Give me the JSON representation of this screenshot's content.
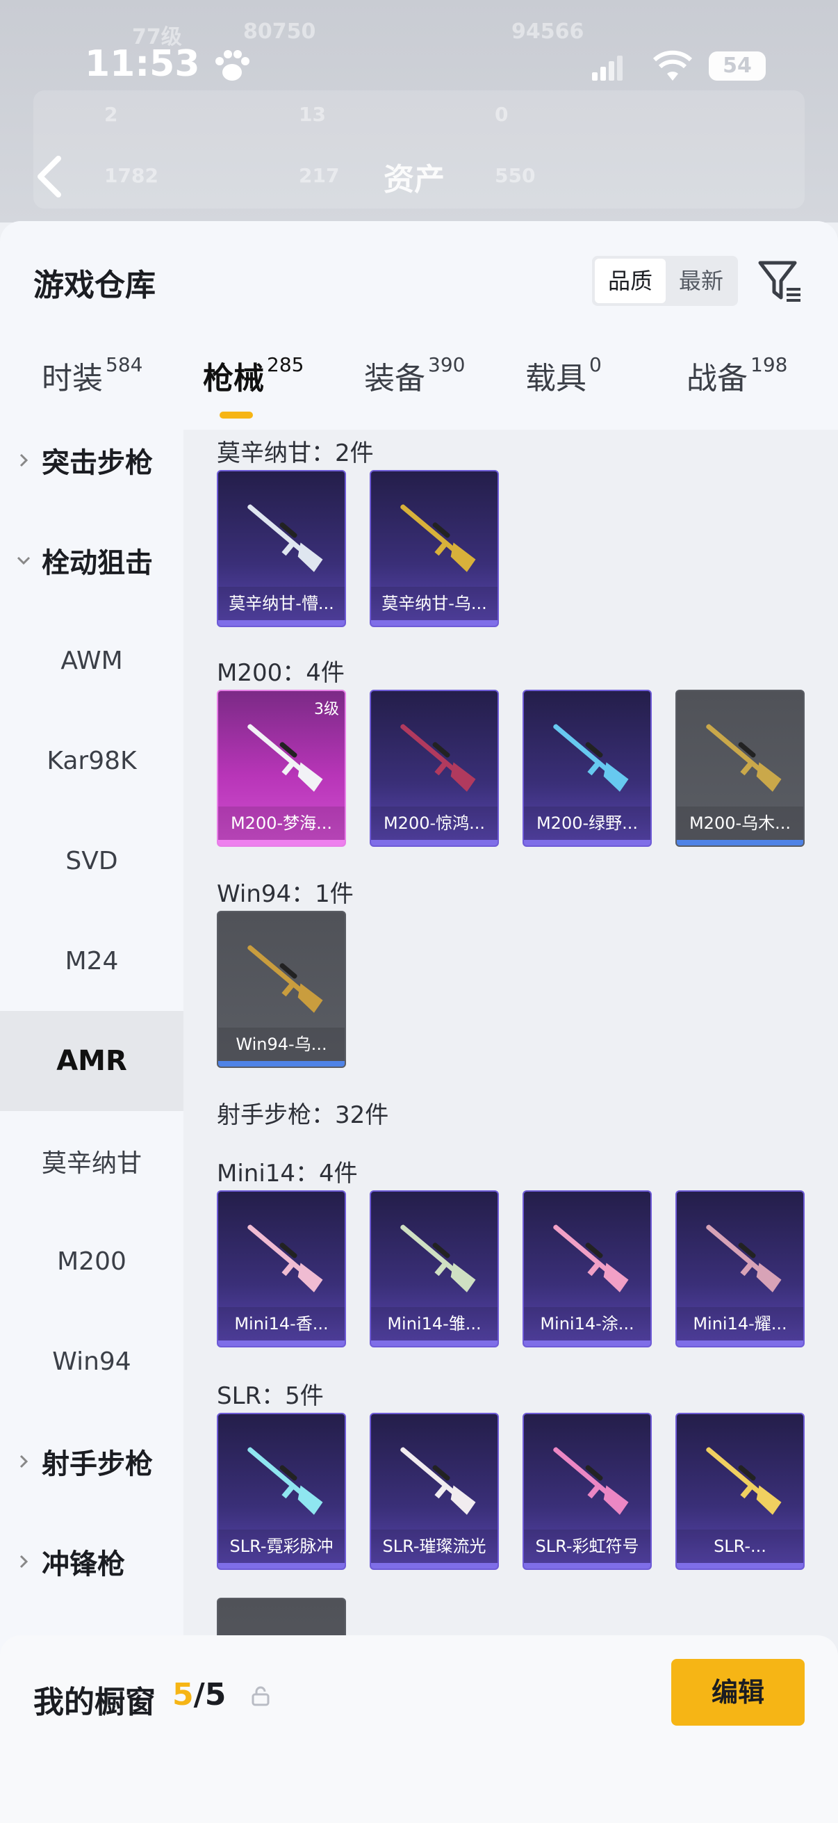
{
  "header": {
    "time": "11:53",
    "battery": "54",
    "page_title": "资产",
    "blurred": {
      "level": "77级",
      "score_a": "80750",
      "score_b": "94566",
      "stat_1": "2",
      "stat_2": "13",
      "stat_3": "0",
      "stat_4": "1782",
      "stat_5": "217",
      "stat_6": "550"
    }
  },
  "warehouse": {
    "title": "游戏仓库",
    "sort_options": [
      "品质",
      "最新"
    ],
    "tabs": [
      {
        "name": "时装",
        "count": "584"
      },
      {
        "name": "枪械",
        "count": "285"
      },
      {
        "name": "装备",
        "count": "390"
      },
      {
        "name": "载具",
        "count": "0"
      },
      {
        "name": "战备",
        "count": "198"
      }
    ],
    "sidebar": [
      {
        "label": "突击步枪",
        "type": "group",
        "expanded": false
      },
      {
        "label": "栓动狙击",
        "type": "group",
        "expanded": true
      },
      {
        "label": "AWM",
        "type": "item"
      },
      {
        "label": "Kar98K",
        "type": "item"
      },
      {
        "label": "SVD",
        "type": "item"
      },
      {
        "label": "M24",
        "type": "item"
      },
      {
        "label": "AMR",
        "type": "item",
        "selected": true
      },
      {
        "label": "莫辛纳甘",
        "type": "item"
      },
      {
        "label": "M200",
        "type": "item"
      },
      {
        "label": "Win94",
        "type": "item"
      },
      {
        "label": "射手步枪",
        "type": "group",
        "expanded": false
      },
      {
        "label": "冲锋枪",
        "type": "group",
        "expanded": false
      }
    ],
    "sections": {
      "mosin": {
        "title": "莫辛纳甘：2件",
        "items": [
          {
            "label": "莫辛纳甘-懵...",
            "style": "purple",
            "gun": "#dfe6f0"
          },
          {
            "label": "莫辛纳甘-乌...",
            "style": "purple",
            "gun": "#d8b13a"
          }
        ]
      },
      "m200": {
        "title": "M200：4件",
        "items": [
          {
            "label": "M200-梦海...",
            "style": "pink",
            "gun": "#f2f2f6",
            "level": "3级"
          },
          {
            "label": "M200-惊鸿...",
            "style": "purple",
            "gun": "#b13a5e"
          },
          {
            "label": "M200-绿野...",
            "style": "purple",
            "gun": "#67c9f0"
          },
          {
            "label": "M200-乌木...",
            "style": "gray",
            "gun": "#caa84a"
          }
        ]
      },
      "win94": {
        "title": "Win94：1件",
        "items": [
          {
            "label": "Win94-乌...",
            "style": "gray",
            "gun": "#c99d3e"
          }
        ]
      },
      "marksman": {
        "title": "射手步枪：32件"
      },
      "mini14": {
        "title": "Mini14：4件",
        "items": [
          {
            "label": "Mini14-香...",
            "style": "purple",
            "gun": "#f0bcd2"
          },
          {
            "label": "Mini14-雏...",
            "style": "purple",
            "gun": "#cfe0c3"
          },
          {
            "label": "Mini14-涂...",
            "style": "purple",
            "gun": "#f1a0c6"
          },
          {
            "label": "Mini14-耀...",
            "style": "purple",
            "gun": "#d8a3b7"
          }
        ]
      },
      "slr": {
        "title": "SLR：5件",
        "items": [
          {
            "label": "SLR-霓彩脉冲",
            "style": "purple",
            "gun": "#8fe6f0"
          },
          {
            "label": "SLR-璀璨流光",
            "style": "purple",
            "gun": "#f1ecef"
          },
          {
            "label": "SLR-彩虹符号",
            "style": "purple",
            "gun": "#ec87c4"
          },
          {
            "label": "SLR-...",
            "style": "purple",
            "gun": "#f0d060"
          }
        ]
      }
    }
  },
  "bottom": {
    "window_label": "我的橱窗",
    "count_current": "5",
    "count_total": "/5",
    "edit_label": "编辑"
  },
  "colors": {
    "accent": "#f6b515",
    "card_purple": "#3a2f78",
    "card_pink": "#b835b8",
    "card_gray": "#5a5d64"
  }
}
